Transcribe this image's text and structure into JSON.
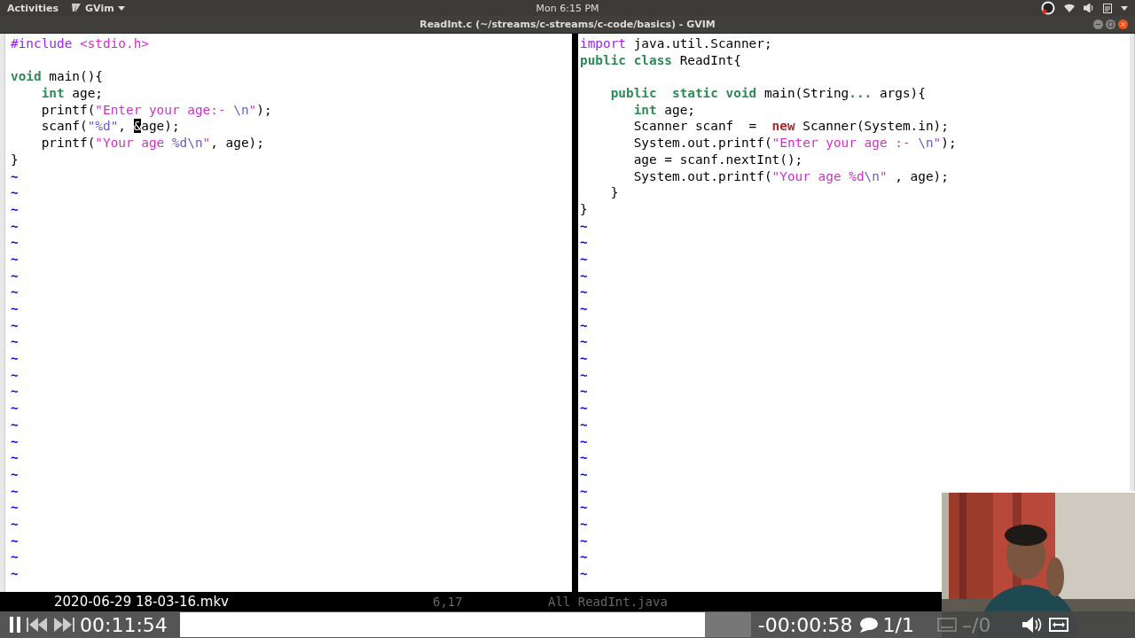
{
  "top_bar": {
    "activities": "Activities",
    "app_menu": "GVim",
    "clock": "Mon  6:15 PM"
  },
  "window": {
    "title": "ReadInt.c (~/streams/c-streams/c-code/basics) - GVIM"
  },
  "panes": [
    {
      "lines": [
        {
          "kind": "code",
          "tokens": [
            {
              "text": "#include ",
              "kind": "preproc"
            },
            {
              "text": "<stdio.h>",
              "kind": "string"
            }
          ]
        },
        {
          "kind": "blank"
        },
        {
          "kind": "code",
          "tokens": [
            {
              "text": "void",
              "kind": "type"
            },
            {
              "text": " main(){",
              "kind": "plain"
            }
          ]
        },
        {
          "kind": "code",
          "tokens": [
            {
              "text": "    int",
              "kind": "type"
            },
            {
              "text": " age;",
              "kind": "plain"
            }
          ]
        },
        {
          "kind": "code",
          "tokens": [
            {
              "text": "    printf(",
              "kind": "plain"
            },
            {
              "text": "\"Enter your age:- ",
              "kind": "string"
            },
            {
              "text": "\\n",
              "kind": "special"
            },
            {
              "text": "\"",
              "kind": "string"
            },
            {
              "text": ");",
              "kind": "plain"
            }
          ]
        },
        {
          "kind": "code",
          "tokens": [
            {
              "text": "    scanf(",
              "kind": "plain"
            },
            {
              "text": "\"%d\"",
              "kind": "special"
            },
            {
              "text": ", ",
              "kind": "plain"
            },
            {
              "text": "&",
              "kind": "cursor"
            },
            {
              "text": "age);",
              "kind": "plain"
            }
          ]
        },
        {
          "kind": "code",
          "tokens": [
            {
              "text": "    printf(",
              "kind": "plain"
            },
            {
              "text": "\"Your age ",
              "kind": "string"
            },
            {
              "text": "%d\\n",
              "kind": "special"
            },
            {
              "text": "\"",
              "kind": "string"
            },
            {
              "text": ", age);",
              "kind": "plain"
            }
          ]
        },
        {
          "kind": "code",
          "tokens": [
            {
              "text": "}",
              "kind": "plain"
            }
          ]
        }
      ],
      "tildes": [
        "~",
        "~",
        "~",
        "~",
        "~",
        "~",
        "~",
        "~",
        "~",
        "~",
        "~",
        "~",
        "~",
        "~",
        "~",
        "~",
        "~",
        "~",
        "~",
        "~",
        "~",
        "~",
        "~",
        "~",
        "~"
      ],
      "status": "6,17"
    },
    {
      "lines": [
        {
          "kind": "code",
          "tokens": [
            {
              "text": "import",
              "kind": "preproc"
            },
            {
              "text": " java.util.Scanner;",
              "kind": "plain"
            }
          ]
        },
        {
          "kind": "code",
          "tokens": [
            {
              "text": "public class",
              "kind": "type"
            },
            {
              "text": " ReadInt{",
              "kind": "plain"
            }
          ]
        },
        {
          "kind": "blank"
        },
        {
          "kind": "code",
          "tokens": [
            {
              "text": "    public  static void",
              "kind": "type"
            },
            {
              "text": " main(String",
              "kind": "plain"
            },
            {
              "text": "...",
              "kind": "type"
            },
            {
              "text": " args){",
              "kind": "plain"
            }
          ]
        },
        {
          "kind": "code",
          "tokens": [
            {
              "text": "       int",
              "kind": "type"
            },
            {
              "text": " age;",
              "kind": "plain"
            }
          ]
        },
        {
          "kind": "code",
          "tokens": [
            {
              "text": "       Scanner scanf  =  ",
              "kind": "plain"
            },
            {
              "text": "new",
              "kind": "statement"
            },
            {
              "text": " Scanner(System.in);",
              "kind": "plain"
            }
          ]
        },
        {
          "kind": "code",
          "tokens": [
            {
              "text": "       System.out.printf(",
              "kind": "plain"
            },
            {
              "text": "\"Enter your age :- ",
              "kind": "string"
            },
            {
              "text": "\\n",
              "kind": "special"
            },
            {
              "text": "\"",
              "kind": "string"
            },
            {
              "text": ");",
              "kind": "plain"
            }
          ]
        },
        {
          "kind": "code",
          "tokens": [
            {
              "text": "       age = scanf.nextInt();",
              "kind": "plain"
            }
          ]
        },
        {
          "kind": "code",
          "tokens": [
            {
              "text": "       System.out.printf(",
              "kind": "plain"
            },
            {
              "text": "\"Your age %d",
              "kind": "string"
            },
            {
              "text": "\\n",
              "kind": "special"
            },
            {
              "text": "\"",
              "kind": "string"
            },
            {
              "text": " , age);",
              "kind": "plain"
            }
          ]
        },
        {
          "kind": "code",
          "tokens": [
            {
              "text": "    }",
              "kind": "plain"
            }
          ]
        },
        {
          "kind": "code",
          "tokens": [
            {
              "text": "}",
              "kind": "plain"
            }
          ]
        }
      ],
      "tildes": [
        "~",
        "~",
        "~",
        "~",
        "~",
        "~",
        "~",
        "~",
        "~",
        "~",
        "~",
        "~",
        "~",
        "~",
        "~",
        "~",
        "~",
        "~",
        "~",
        "~",
        "~",
        "~"
      ],
      "status": "All ReadInt.java"
    }
  ],
  "player": {
    "file_name": "2020-06-29 18-03-16.mkv",
    "elapsed": "00:11:54",
    "level": 0.92,
    "remaining": "-00:00:58",
    "chat_count": "1/1",
    "subtitles": {
      "label": "–/0",
      "disabled": true
    }
  }
}
